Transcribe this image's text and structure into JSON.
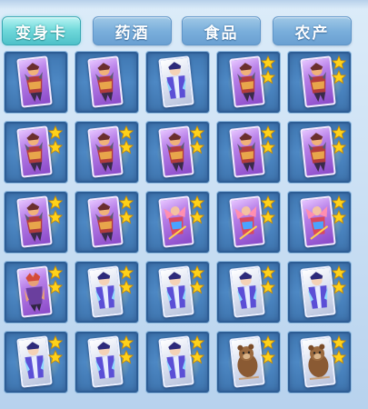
{
  "header": {
    "fragment": ""
  },
  "tabs": [
    {
      "label": "变身卡",
      "active": true
    },
    {
      "label": "药酒",
      "active": false
    },
    {
      "label": "食品",
      "active": false
    },
    {
      "label": "农产",
      "active": false
    }
  ],
  "items": [
    {
      "card": "purple",
      "figure": "demon-warrior",
      "stars": 0
    },
    {
      "card": "purple",
      "figure": "demon-warrior",
      "stars": 0
    },
    {
      "card": "silver",
      "figure": "blue-monk",
      "stars": 0
    },
    {
      "card": "purple",
      "figure": "demon-warrior",
      "stars": 2
    },
    {
      "card": "purple",
      "figure": "demon-warrior",
      "stars": 2
    },
    {
      "card": "purple",
      "figure": "demon-warrior",
      "stars": 2
    },
    {
      "card": "purple",
      "figure": "demon-warrior",
      "stars": 2
    },
    {
      "card": "purple",
      "figure": "demon-warrior",
      "stars": 2
    },
    {
      "card": "purple",
      "figure": "demon-warrior",
      "stars": 2
    },
    {
      "card": "purple",
      "figure": "demon-warrior",
      "stars": 2
    },
    {
      "card": "purple",
      "figure": "demon-warrior",
      "stars": 2
    },
    {
      "card": "purple",
      "figure": "demon-warrior",
      "stars": 2
    },
    {
      "card": "purple",
      "figure": "winged-lancer",
      "stars": 2
    },
    {
      "card": "purple",
      "figure": "winged-lancer",
      "stars": 2
    },
    {
      "card": "purple",
      "figure": "winged-lancer",
      "stars": 2
    },
    {
      "card": "purple",
      "figure": "beast-brawler",
      "stars": 2
    },
    {
      "card": "silver",
      "figure": "blue-monk",
      "stars": 2
    },
    {
      "card": "silver",
      "figure": "blue-monk",
      "stars": 2
    },
    {
      "card": "silver",
      "figure": "blue-monk",
      "stars": 2
    },
    {
      "card": "silver",
      "figure": "blue-monk",
      "stars": 2
    },
    {
      "card": "silver",
      "figure": "blue-monk",
      "stars": 2
    },
    {
      "card": "silver",
      "figure": "blue-monk",
      "stars": 2
    },
    {
      "card": "silver",
      "figure": "blue-monk",
      "stars": 2
    },
    {
      "card": "silver",
      "figure": "brown-bear",
      "stars": 2
    },
    {
      "card": "silver",
      "figure": "brown-bear",
      "stars": 2
    }
  ],
  "colors": {
    "active_tab": "#5fcfd3",
    "inactive_tab": "#7fb3de",
    "slot": "#4a84c0",
    "star": "#ffd21a",
    "purple_card": "#a56bdc",
    "silver_card": "#e6ebf7"
  }
}
